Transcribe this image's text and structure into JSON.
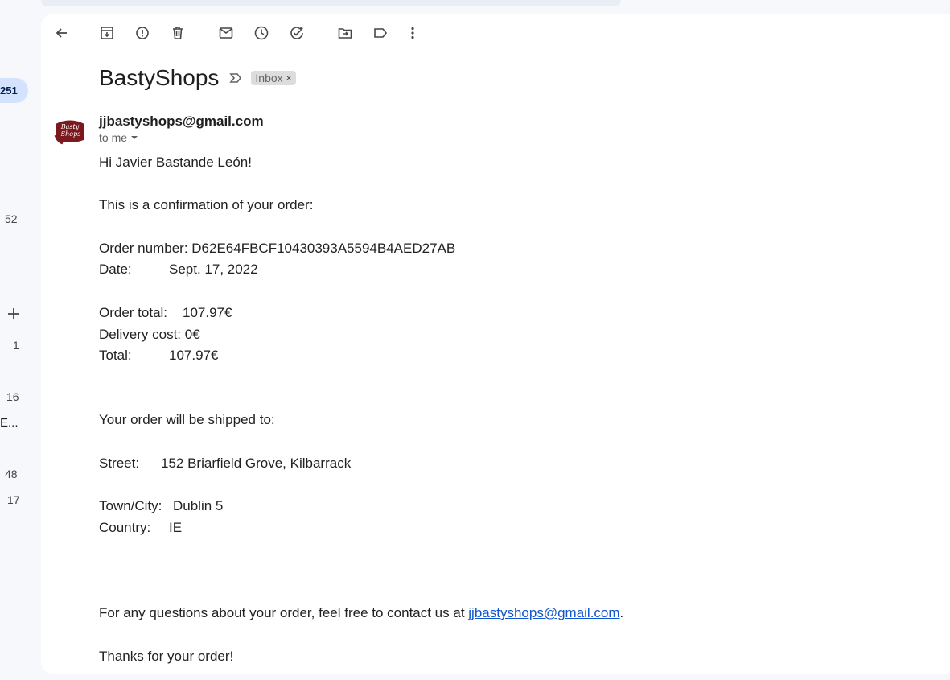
{
  "sidebar": {
    "inbox_count": "251",
    "counts": [
      "52",
      "1",
      "16",
      "E...",
      "48",
      "17"
    ]
  },
  "toolbar": {
    "icons": [
      "back-arrow-icon",
      "archive-icon",
      "report-spam-icon",
      "delete-icon",
      "mark-unread-icon",
      "snooze-icon",
      "add-task-icon",
      "move-to-icon",
      "labels-icon",
      "more-vert-icon"
    ]
  },
  "email": {
    "subject": "BastyShops",
    "label": "Inbox",
    "label_close": "×",
    "sender": "jjbastyshops@gmail.com",
    "to": "to me",
    "avatar_text_1": "Basty",
    "avatar_text_2": "Shops",
    "greeting": "Hi Javier Bastande León!",
    "confirm": "This is a confirmation of your order:",
    "order_number": "Order number: D62E64FBCF10430393A5594B4AED27AB",
    "date_label": "Date:",
    "date_value": "Sept. 17, 2022",
    "order_total_label": "Order total:",
    "order_total_value": "107.97€",
    "delivery": "Delivery cost: 0€",
    "total_label": "Total:",
    "total_value": "107.97€",
    "shipped_to": "Your order will be shipped to:",
    "street_label": "Street:",
    "street_value": "152 Briarfield Grove, Kilbarrack",
    "town_label": "Town/City:",
    "town_value": "Dublin 5",
    "country_label": "Country:",
    "country_value": "IE",
    "questions_prefix": "For any questions about your order, feel free to contact us at ",
    "questions_link": "jjbastyshops@gmail.com",
    "questions_suffix": ".",
    "thanks": "Thanks for your order!"
  },
  "colors": {
    "page_bg": "#f6f8fc",
    "panel_bg": "#ffffff",
    "badge_bg": "#d3e3fd",
    "link": "#1155cc",
    "brand": "#7b1a1e"
  }
}
